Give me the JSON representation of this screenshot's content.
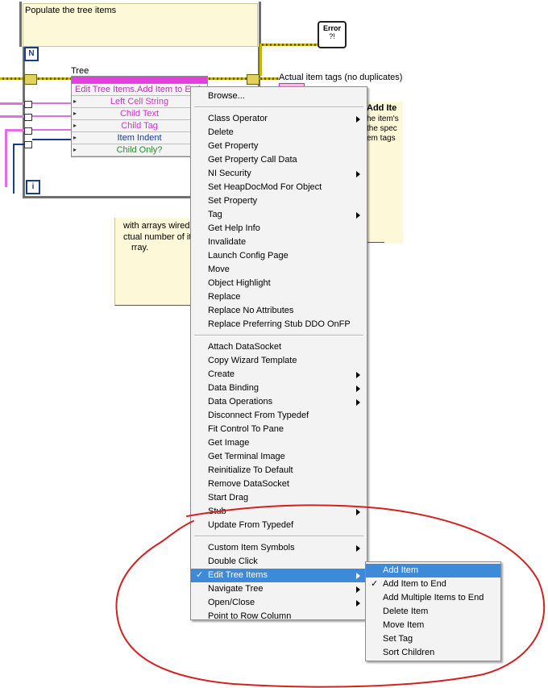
{
  "diagram": {
    "loop_note": "Populate the tree items",
    "loop_count_terminal": "N",
    "loop_iteration_terminal": "i",
    "error_indicator": "Error",
    "error_indicator_symbol": "?!",
    "tree_label": "Tree",
    "property_node": {
      "method": "Edit Tree Items.Add Item to End",
      "inputs": [
        {
          "label": "Left Cell String",
          "color": "#d030d0"
        },
        {
          "label": "Child Text",
          "color": "#d030d0"
        },
        {
          "label": "Child Tag",
          "color": "#d030d0"
        },
        {
          "label": "Item Indent",
          "color": "#1a3a8c"
        },
        {
          "label": "Child Only?",
          "color": "#2a8a2a"
        }
      ]
    },
    "output_label": "Actual item tags (no duplicates)",
    "right_note": {
      "heading": "Add Ite",
      "lines": [
        "he item's",
        "the spec",
        "em tags"
      ]
    },
    "bottom_note": {
      "lines": [
        "with arrays wired",
        "ctual number of it",
        "rray."
      ]
    }
  },
  "context_menu": {
    "groups": [
      [
        {
          "label": "Browse...",
          "submenu": false
        }
      ],
      [
        {
          "label": "Class Operator",
          "submenu": true
        },
        {
          "label": "Delete",
          "submenu": false
        },
        {
          "label": "Get Property",
          "submenu": false
        },
        {
          "label": "Get Property Call Data",
          "submenu": false
        },
        {
          "label": "NI Security",
          "submenu": true
        },
        {
          "label": "Set HeapDocMod For Object",
          "submenu": false
        },
        {
          "label": "Set Property",
          "submenu": false
        },
        {
          "label": "Tag",
          "submenu": true
        },
        {
          "label": "Get Help Info",
          "submenu": false
        },
        {
          "label": "Invalidate",
          "submenu": false
        },
        {
          "label": "Launch Config Page",
          "submenu": false
        },
        {
          "label": "Move",
          "submenu": false
        },
        {
          "label": "Object Highlight",
          "submenu": false
        },
        {
          "label": "Replace",
          "submenu": false
        },
        {
          "label": "Replace No Attributes",
          "submenu": false
        },
        {
          "label": "Replace Preferring Stub DDO OnFP",
          "submenu": false
        }
      ],
      [
        {
          "label": "Attach DataSocket",
          "submenu": false
        },
        {
          "label": "Copy Wizard Template",
          "submenu": false
        },
        {
          "label": "Create",
          "submenu": true
        },
        {
          "label": "Data Binding",
          "submenu": true
        },
        {
          "label": "Data Operations",
          "submenu": true
        },
        {
          "label": "Disconnect From Typedef",
          "submenu": false
        },
        {
          "label": "Fit Control To Pane",
          "submenu": false
        },
        {
          "label": "Get Image",
          "submenu": false
        },
        {
          "label": "Get Terminal Image",
          "submenu": false
        },
        {
          "label": "Reinitialize To Default",
          "submenu": false
        },
        {
          "label": "Remove DataSocket",
          "submenu": false
        },
        {
          "label": "Start Drag",
          "submenu": false
        },
        {
          "label": "Stub",
          "submenu": true
        },
        {
          "label": "Update From Typedef",
          "submenu": false
        }
      ],
      [
        {
          "label": "Custom Item Symbols",
          "submenu": true
        },
        {
          "label": "Double Click",
          "submenu": false
        },
        {
          "label": "Edit Tree Items",
          "submenu": true,
          "checked": true,
          "highlighted": true
        },
        {
          "label": "Navigate Tree",
          "submenu": true
        },
        {
          "label": "Open/Close",
          "submenu": true
        },
        {
          "label": "Point to Row Column",
          "submenu": false
        }
      ]
    ]
  },
  "submenu": {
    "items": [
      {
        "label": "Add Item",
        "highlighted": true
      },
      {
        "label": "Add Item to End",
        "checked": true
      },
      {
        "label": "Add Multiple Items to End"
      },
      {
        "label": "Delete Item"
      },
      {
        "label": "Move Item"
      },
      {
        "label": "Set Tag"
      },
      {
        "label": "Sort Children"
      }
    ]
  },
  "colors": {
    "menu_bg": "#f3f3f3",
    "highlight": "#3c8ad8",
    "annotation_circle": "#d42020",
    "note_bg": "#fcf8d8"
  }
}
